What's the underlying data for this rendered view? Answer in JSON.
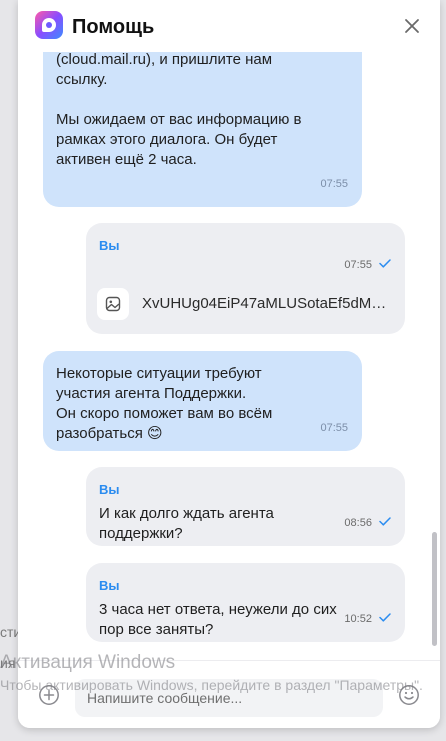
{
  "header": {
    "title": "Помощь",
    "close_icon": "close-icon",
    "logo_icon": "chat-logo-icon"
  },
  "messages": [
    {
      "type": "incoming",
      "text": "попробуйте загрузить его в любое\nоблако, например, Облако Mail\n(cloud.mail.ru), и пришлите нам\nссылку.\n\nМы ожидаем от вас информацию в\nрамках этого диалога. Он будет\nактивен ещё 2 часа.",
      "time": "07:55"
    },
    {
      "type": "outgoing",
      "sender": "Вы",
      "time": "07:55",
      "file_name": "XvUHUg04EiP47aMLUSotaEf5dMwl...",
      "file_icon": "image-file-icon",
      "status_icon": "checkmark-icon"
    },
    {
      "type": "incoming",
      "text": "Некоторые ситуации требуют\nучастия агента Поддержки.\nОн скоро поможет вам во всём\nразобраться 😊",
      "time": "07:55"
    },
    {
      "type": "outgoing",
      "sender": "Вы",
      "text": "И как долго ждать агента\nподдержки?",
      "time": "08:56",
      "status_icon": "checkmark-icon"
    },
    {
      "type": "outgoing",
      "sender": "Вы",
      "text": "3 часа нет ответа, неужели до сих\nпор все заняты?",
      "time": "10:52",
      "status_icon": "checkmark-icon"
    }
  ],
  "composer": {
    "placeholder": "Напишите сообщение...",
    "attach_icon": "plus-circle-icon",
    "emoji_icon": "smiley-icon"
  },
  "background": {
    "fragment_1": "сти",
    "fragment_2": "ия"
  },
  "watermark": {
    "line1": "Активация Windows",
    "line2": "Чтобы активировать Windows, перейдите в раздел \"Параметры\"."
  },
  "colors": {
    "incoming_bubble": "#cfe3fb",
    "outgoing_bubble": "#edeef2",
    "sender_name": "#2b8cf0",
    "checkmark": "#2b8cf0"
  }
}
